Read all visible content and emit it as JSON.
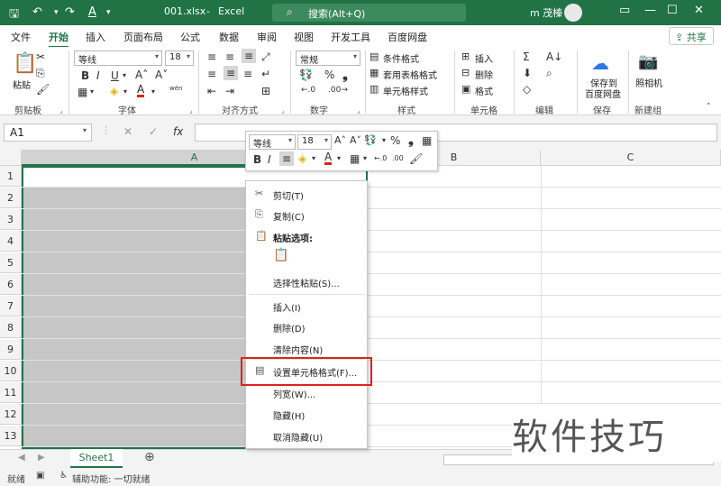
{
  "titlebar": {
    "autosave_icon": "save-icon",
    "filename": "001.xlsx",
    "dash": "-",
    "app": "Excel",
    "search": "搜索(Alt+Q)",
    "user": "m 茂榛",
    "accent": "#217346"
  },
  "tabs": [
    "文件",
    "开始",
    "插入",
    "页面布局",
    "公式",
    "数据",
    "审阅",
    "视图",
    "开发工具",
    "百度网盘"
  ],
  "share": "共享",
  "ribbon": {
    "paste": "粘贴",
    "clipboard": "剪贴板",
    "font_name": "等线",
    "font_size": "18",
    "font": "字体",
    "alignment": "对齐方式",
    "number_format": "常规",
    "number": "数字",
    "cond_format": "条件格式",
    "table_format": "套用表格格式",
    "cell_style": "单元格样式",
    "styles": "样式",
    "insert": "插入",
    "delete": "删除",
    "format": "格式",
    "cells": "单元格",
    "editing": "编辑",
    "save_to": "保存到",
    "baidu": "百度网盘",
    "save": "保存",
    "camera": "照相机",
    "newgroup": "新建组",
    "bold": "B",
    "italic": "I",
    "underline": "U",
    "percent": "%",
    "wen": "wén"
  },
  "namebox": "A1",
  "fx": "fx",
  "columns": [
    "A",
    "B",
    "C"
  ],
  "rows": [
    "1",
    "2",
    "3",
    "4",
    "5",
    "6",
    "7",
    "8",
    "9",
    "10",
    "11",
    "12",
    "13"
  ],
  "sheet": "Sheet1",
  "status": {
    "ready": "就绪",
    "accessibility": "辅助功能: 一切就绪"
  },
  "mini": {
    "font": "等线",
    "size": "18",
    "bold": "B",
    "italic": "I",
    "percent": "%",
    "comma": ",",
    "inc": "←.0",
    "dec": ".00"
  },
  "context_menu": {
    "cut": "剪切(T)",
    "copy": "复制(C)",
    "paste_options": "粘贴选项:",
    "paste_special": "选择性粘贴(S)...",
    "insert": "插入(I)",
    "delete": "删除(D)",
    "clear": "清除内容(N)",
    "format_cells": "设置单元格格式(F)...",
    "col_width": "列宽(W)...",
    "hide": "隐藏(H)",
    "unhide": "取消隐藏(U)"
  },
  "watermark": "软件技巧"
}
